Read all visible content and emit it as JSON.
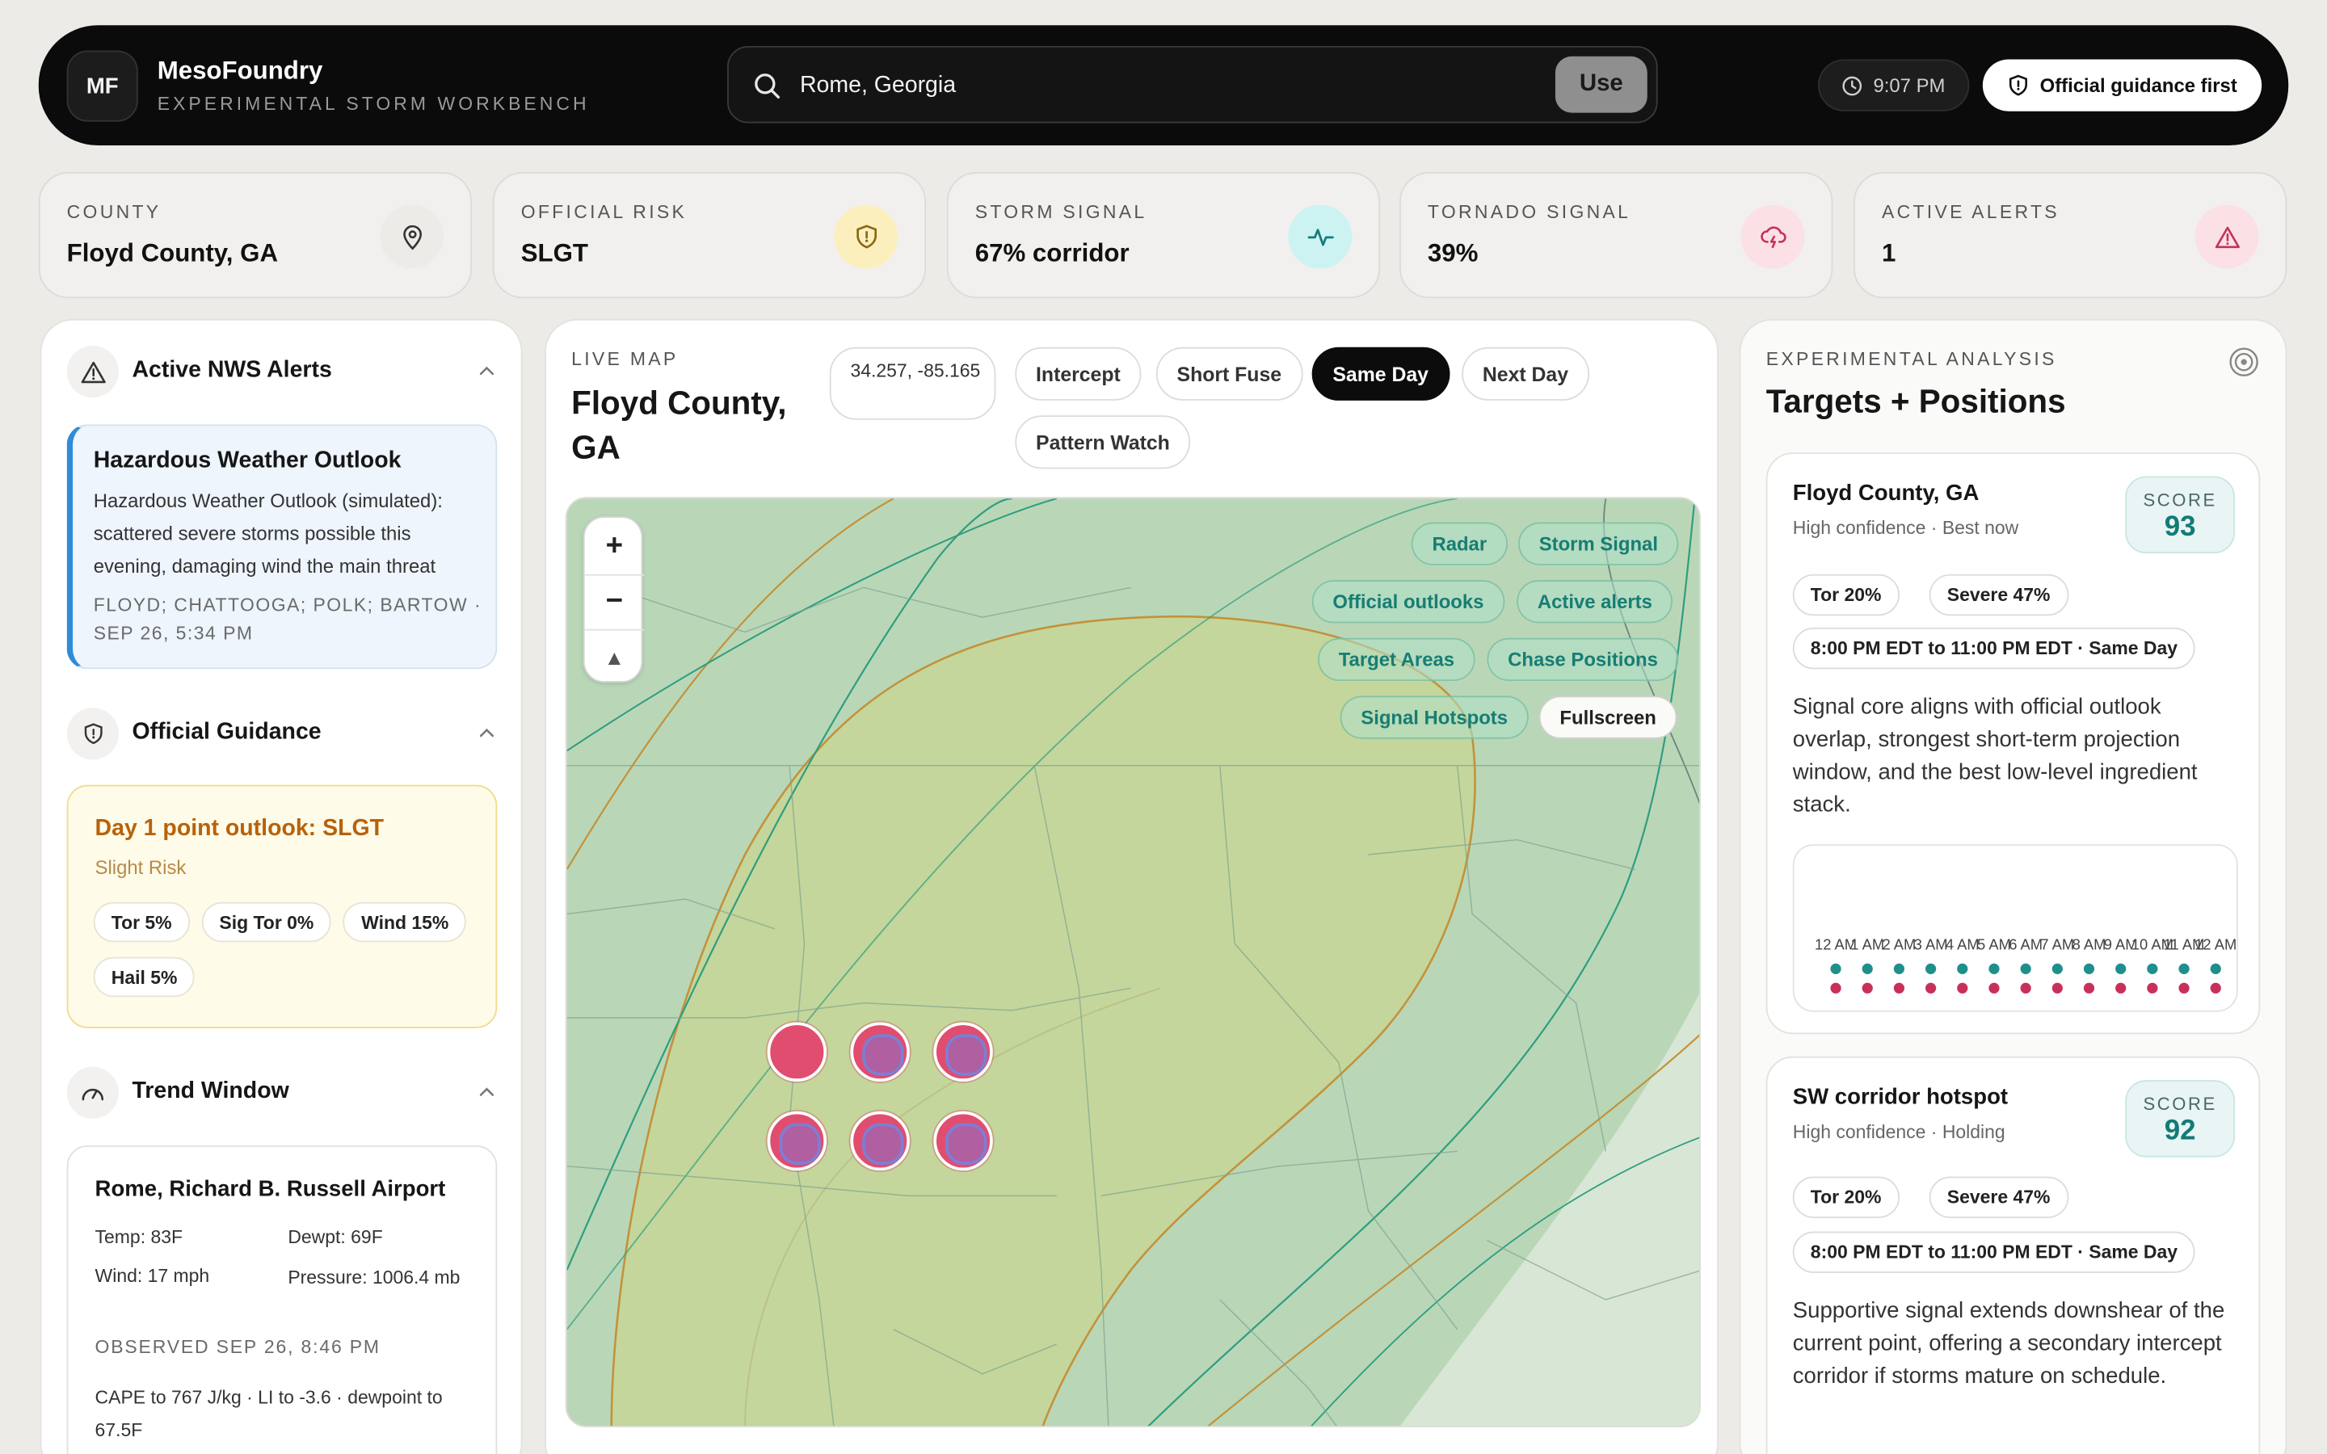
{
  "header": {
    "logo": "MF",
    "app_name": "MesoFoundry",
    "app_subtitle": "EXPERIMENTAL STORM WORKBENCH",
    "search_value": "Rome, Georgia",
    "use_label": "Use",
    "time": "9:07 PM",
    "guidance_label": "Official guidance first"
  },
  "stats": [
    {
      "label": "COUNTY",
      "value": "Floyd County, GA",
      "icon": "map-pin-icon",
      "color": "#ecebe8"
    },
    {
      "label": "OFFICIAL RISK",
      "value": "SLGT",
      "icon": "shield-icon",
      "color": "#fcefbe"
    },
    {
      "label": "STORM SIGNAL",
      "value": "67% corridor",
      "icon": "activity-icon",
      "color": "#cdf2f2"
    },
    {
      "label": "TORNADO SIGNAL",
      "value": "39%",
      "icon": "cloud-lightning-icon",
      "color": "#fbe0e6"
    },
    {
      "label": "ACTIVE ALERTS",
      "value": "1",
      "icon": "alert-triangle-icon",
      "color": "#fbe0e6"
    }
  ],
  "left": {
    "alerts_title": "Active NWS Alerts",
    "alert": {
      "title": "Hazardous Weather Outlook",
      "body": "Hazardous Weather Outlook (simulated): scattered severe storms possible this evening, damaging wind the main threat",
      "meta": "FLOYD; CHATTOOGA; POLK; BARTOW · SEP 26, 5:34 PM"
    },
    "guidance_title": "Official Guidance",
    "outlook": {
      "title": "Day 1 point outlook: SLGT",
      "subtitle": "Slight Risk",
      "chips": [
        "Tor 5%",
        "Sig Tor 0%",
        "Wind 15%",
        "Hail 5%"
      ]
    },
    "trend_title": "Trend Window",
    "obs": {
      "station": "Rome, Richard B. Russell Airport",
      "temp": "Temp: 83F",
      "dewpt": "Dewpt: 69F",
      "wind": "Wind: 17 mph",
      "pressure": "Pressure: 1006.4 mb",
      "observed": "OBSERVED SEP 26, 8:46 PM",
      "note": "CAPE to 767 J/kg · LI to -3.6 · dewpoint to 67.5F"
    }
  },
  "center": {
    "label": "LIVE MAP",
    "title": "Floyd County, GA",
    "coords": "34.257, -85.165",
    "modes": [
      "Intercept",
      "Short Fuse",
      "Same Day",
      "Next Day",
      "Pattern Watch"
    ],
    "active_mode": "Same Day",
    "zoom_in": "+",
    "zoom_out": "−",
    "compass": "▲",
    "layers": [
      "Radar",
      "Storm Signal",
      "Official outlooks",
      "Active alerts",
      "Target Areas",
      "Chase Positions",
      "Signal Hotspots"
    ],
    "fullscreen": "Fullscreen"
  },
  "right": {
    "label": "EXPERIMENTAL ANALYSIS",
    "title": "Targets + Positions",
    "score_label": "SCORE",
    "targets": [
      {
        "name": "Floyd County, GA",
        "confidence": "High confidence · Best now",
        "score": "93",
        "tor": "Tor 20%",
        "severe": "Severe 47%",
        "window": "8:00 PM EDT to 11:00 PM EDT · Same Day",
        "desc": "Signal core aligns with official outlook overlap, strongest short-term projection window, and the best low-level ingredient stack."
      },
      {
        "name": "SW corridor hotspot",
        "confidence": "High confidence · Holding",
        "score": "92",
        "tor": "Tor 20%",
        "severe": "Severe 47%",
        "window": "8:00 PM EDT to 11:00 PM EDT · Same Day",
        "desc": "Supportive signal extends downshear of the current point, offering a secondary intercept corridor if storms mature on schedule."
      }
    ],
    "timeline_hours": [
      "12 AM",
      "1 AM",
      "2 AM",
      "3 AM",
      "4 AM",
      "5 AM",
      "6 AM",
      "7 AM",
      "8 AM",
      "9 AM",
      "10 AM",
      "11 AM",
      "12 AM"
    ]
  }
}
